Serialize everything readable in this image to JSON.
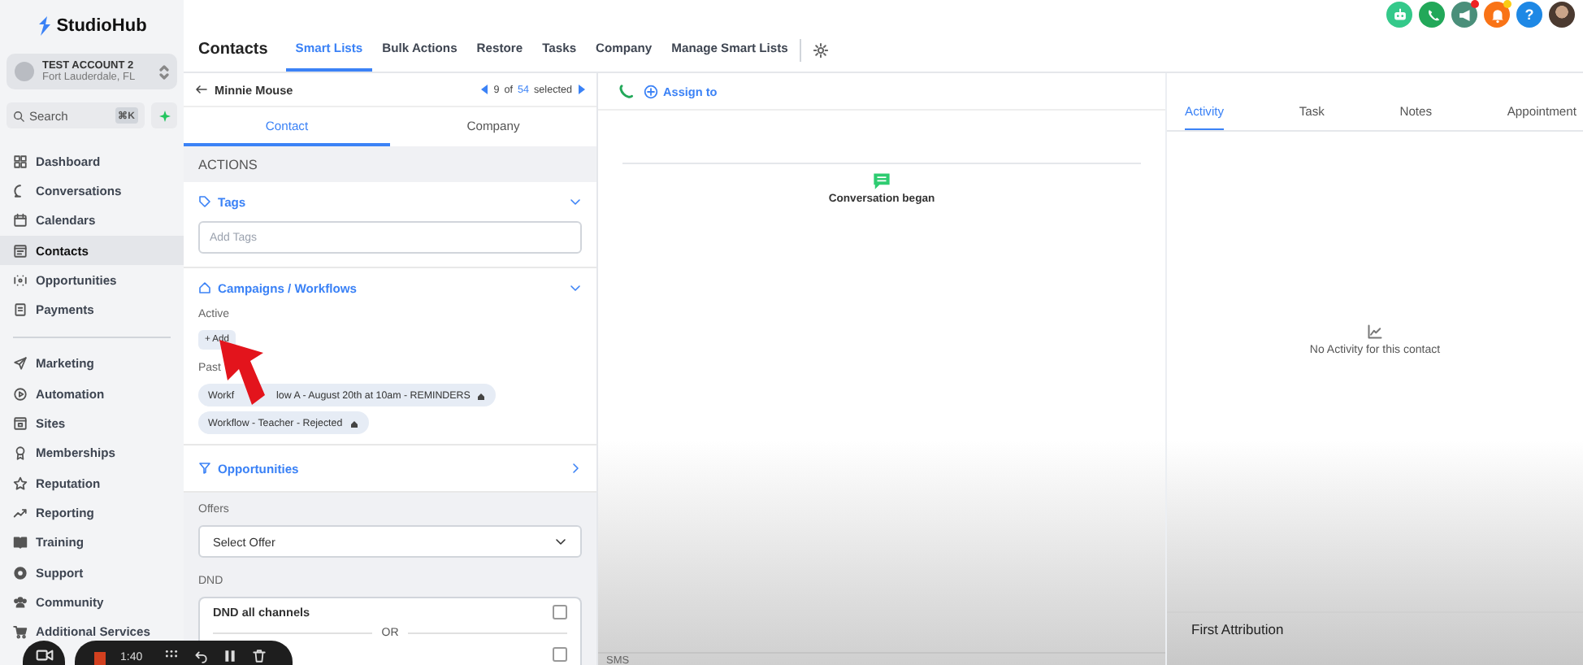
{
  "brand": {
    "name": "StudioHub"
  },
  "account": {
    "name": "TEST ACCOUNT 2",
    "location": "Fort Lauderdale, FL"
  },
  "search": {
    "placeholder": "Search",
    "shortcut": "⌘K"
  },
  "sidebar": {
    "sections": [
      {
        "items": [
          {
            "label": "Dashboard",
            "selected": false
          },
          {
            "label": "Conversations",
            "selected": false
          },
          {
            "label": "Calendars",
            "selected": false
          },
          {
            "label": "Contacts",
            "selected": true
          },
          {
            "label": "Opportunities",
            "selected": false
          },
          {
            "label": "Payments",
            "selected": false
          }
        ]
      },
      {
        "items": [
          {
            "label": "Marketing",
            "selected": false
          },
          {
            "label": "Automation",
            "selected": false
          },
          {
            "label": "Sites",
            "selected": false
          },
          {
            "label": "Memberships",
            "selected": false
          },
          {
            "label": "Reputation",
            "selected": false
          },
          {
            "label": "Reporting",
            "selected": false
          },
          {
            "label": "Training",
            "selected": false
          },
          {
            "label": "Support",
            "selected": false
          },
          {
            "label": "Community",
            "selected": false
          },
          {
            "label": "Additional Services",
            "selected": false
          }
        ]
      }
    ]
  },
  "header": {
    "title": "Contacts",
    "tabs": [
      {
        "label": "Smart Lists",
        "selected": true
      },
      {
        "label": "Bulk Actions",
        "selected": false
      },
      {
        "label": "Restore",
        "selected": false
      },
      {
        "label": "Tasks",
        "selected": false
      },
      {
        "label": "Company",
        "selected": false
      },
      {
        "label": "Manage Smart Lists",
        "selected": false
      }
    ]
  },
  "top_icons": [
    {
      "kind": "robot",
      "badge": false
    },
    {
      "kind": "phone",
      "badge": false
    },
    {
      "kind": "megaphone",
      "badge": true
    },
    {
      "kind": "bell",
      "badge": true
    },
    {
      "kind": "help",
      "glyph": "?",
      "badge": false
    },
    {
      "kind": "avatar",
      "badge": false
    }
  ],
  "contact": {
    "name": "Minnie Mouse",
    "pager": {
      "index": "9",
      "of": "of",
      "total": "54",
      "suffix": "selected"
    },
    "tabs": [
      {
        "label": "Contact",
        "selected": true
      },
      {
        "label": "Company",
        "selected": false
      }
    ],
    "actions_title": "ACTIONS",
    "tags": {
      "title": "Tags",
      "placeholder": "Add Tags"
    },
    "campaigns": {
      "title": "Campaigns / Workflows",
      "active_label": "Active",
      "add": "+ Add",
      "past_label": "Past",
      "workflows": [
        {
          "parts": [
            "Workf",
            "low A - August 20th at 10am - REMINDERS"
          ]
        },
        {
          "parts": [
            "Workflow - Teacher - Rejected"
          ]
        }
      ]
    },
    "opportunities": {
      "title": "Opportunities",
      "offers_label": "Offers",
      "offer_select": "Select Offer",
      "dnd_label": "DND",
      "dnd_options": [
        {
          "label": "DND all channels",
          "checked": false
        },
        {
          "checked": false
        }
      ],
      "or": "OR"
    }
  },
  "conversation": {
    "assign": "Assign to",
    "event": "Conversation began",
    "composer_tab": "SMS"
  },
  "activity": {
    "tabs": [
      {
        "label": "Activity",
        "selected": true
      },
      {
        "label": "Task",
        "selected": false
      },
      {
        "label": "Notes",
        "selected": false
      },
      {
        "label": "Appointment",
        "selected": false
      }
    ],
    "empty": "No Activity for this contact",
    "attribution_title": "First Attribution"
  },
  "recorder": {
    "time": "1:40"
  }
}
